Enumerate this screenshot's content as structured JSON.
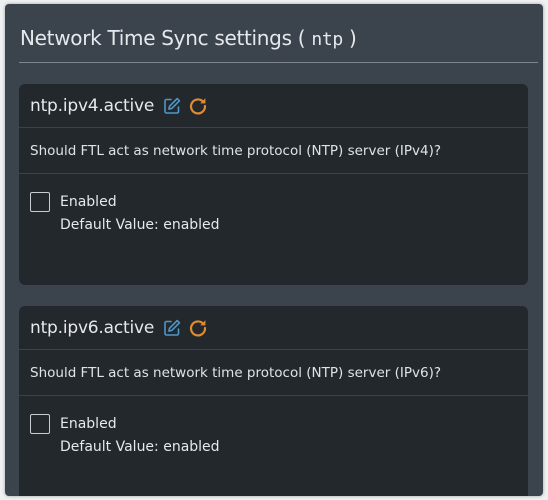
{
  "panel": {
    "title_prefix": "Network Time Sync settings (",
    "title_code": "ntp",
    "title_suffix": ")"
  },
  "settings": [
    {
      "key": "ntp.ipv4.active",
      "description": "Should FTL act as network time protocol (NTP) server (IPv4)?",
      "checkbox_label": "Enabled",
      "checked": false,
      "default_text": "Default Value: enabled"
    },
    {
      "key": "ntp.ipv6.active",
      "description": "Should FTL act as network time protocol (NTP) server (IPv6)?",
      "checkbox_label": "Enabled",
      "checked": false,
      "default_text": "Default Value: enabled"
    }
  ],
  "icons": {
    "edit": "edit-icon",
    "reset": "reset-icon"
  },
  "colors": {
    "edit_icon": "#4f97c6",
    "reset_icon": "#e38a2d",
    "panel_bg": "#3b444d",
    "card_bg": "#23282d"
  }
}
